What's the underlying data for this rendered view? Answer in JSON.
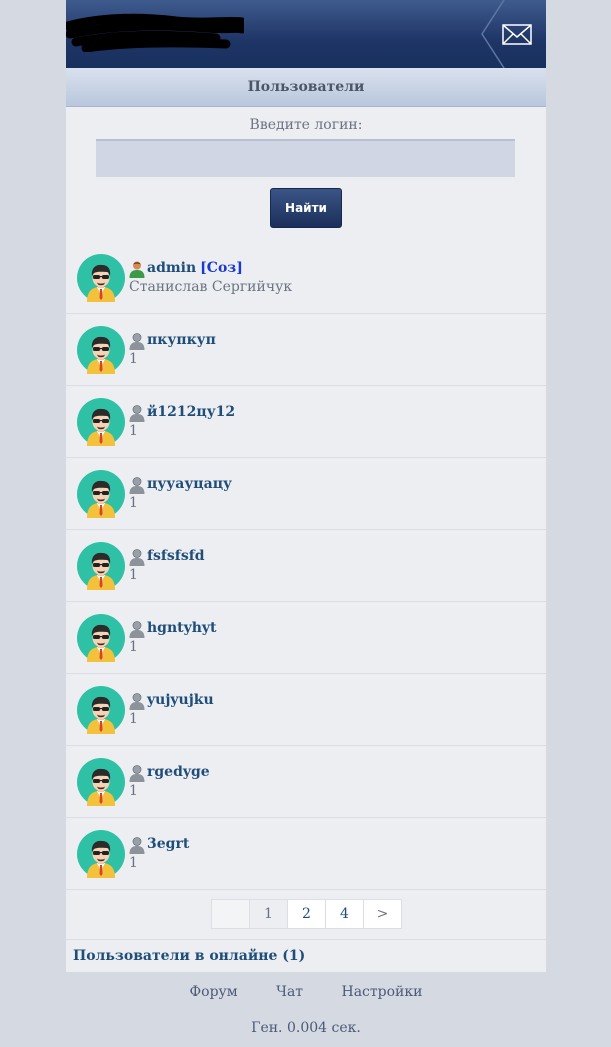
{
  "header": {
    "title": "Пользователи",
    "mail_icon": "envelope-icon"
  },
  "search": {
    "label": "Введите логин:",
    "value": "",
    "button": "Найти"
  },
  "users": [
    {
      "name": "admin",
      "tag": "[Соз]",
      "sub": "Станислав Сергийчук",
      "role": "admin"
    },
    {
      "name": "пкупкуп",
      "sub": "1",
      "role": "user"
    },
    {
      "name": "й1212цу12",
      "sub": "1",
      "role": "user"
    },
    {
      "name": "цууауцацу",
      "sub": "1",
      "role": "user"
    },
    {
      "name": "fsfsfsfd",
      "sub": "1",
      "role": "user"
    },
    {
      "name": "hgntyhyt",
      "sub": "1",
      "role": "user"
    },
    {
      "name": "yujyujku",
      "sub": "1",
      "role": "user"
    },
    {
      "name": "rgedyge",
      "sub": "1",
      "role": "user"
    },
    {
      "name": "3egrt",
      "sub": "1",
      "role": "user"
    }
  ],
  "pagination": {
    "pages": [
      "1",
      "2",
      "4"
    ],
    "current": "1",
    "next": ">"
  },
  "online": "Пользователи в онлайне (1)",
  "footer": {
    "links": [
      "Форум",
      "Чат",
      "Настройки"
    ],
    "gen": "Ген. 0.004 сек."
  },
  "colors": {
    "header": "#1e3566",
    "link": "#1f4d7a",
    "tag": "#1a3acb",
    "avatar_bg": "#2fc1a5"
  }
}
